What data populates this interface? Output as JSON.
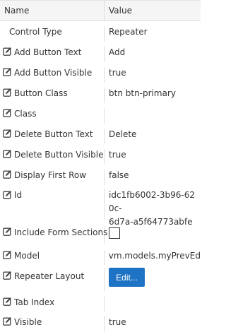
{
  "header": {
    "name": "Name",
    "value": "Value"
  },
  "rows": [
    {
      "name": "Control Type",
      "value": "Repeater"
    },
    {
      "name": "Add Button Text",
      "value": "Add"
    },
    {
      "name": "Add Button Visible",
      "value": "true"
    },
    {
      "name": "Button Class",
      "value": "btn btn-primary"
    },
    {
      "name": "Class",
      "value": ""
    },
    {
      "name": "Delete Button Text",
      "value": "Delete"
    },
    {
      "name": "Delete Button Visible",
      "value": "true"
    },
    {
      "name": "Display First Row",
      "value": "false"
    },
    {
      "name": "Id",
      "value_line1": "idc1fb6002-3b96-620c-",
      "value_line2": "6d7a-a5f64773abfe"
    },
    {
      "name": "Include Form Sections",
      "checked": false
    },
    {
      "name": "Model",
      "value": "vm.models.myPrevEd"
    },
    {
      "name": "Repeater Layout",
      "button_label": "Edit..."
    },
    {
      "name": "Tab Index",
      "value": ""
    },
    {
      "name": "Visible",
      "value": "true"
    }
  ],
  "icons": {
    "edit": "edit-icon"
  },
  "colors": {
    "header_bg": "#f5f5f5",
    "border": "#dcdcdc",
    "button_bg": "#1f73c4",
    "text": "#333333"
  }
}
